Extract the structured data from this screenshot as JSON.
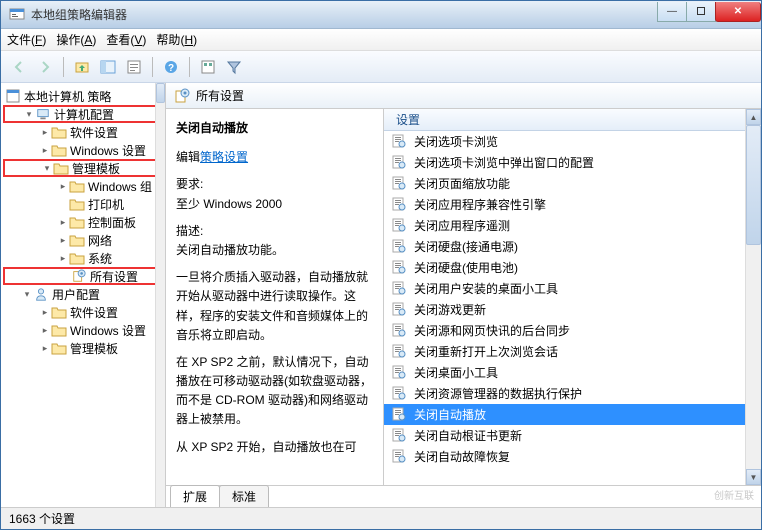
{
  "window": {
    "title": "本地组策略编辑器"
  },
  "menubar": [
    {
      "label": "文件",
      "accel": "F"
    },
    {
      "label": "操作",
      "accel": "A"
    },
    {
      "label": "查看",
      "accel": "V"
    },
    {
      "label": "帮助",
      "accel": "H"
    }
  ],
  "tree": {
    "root": "本地计算机 策略",
    "nodes": [
      {
        "label": "计算机配置",
        "level": 1,
        "twist": "▾",
        "hl": true,
        "icon": "computer"
      },
      {
        "label": "软件设置",
        "level": 2,
        "twist": "▸",
        "icon": "folder"
      },
      {
        "label": "Windows 设置",
        "level": 2,
        "twist": "▸",
        "icon": "folder"
      },
      {
        "label": "管理模板",
        "level": 2,
        "twist": "▾",
        "hl": true,
        "icon": "folder"
      },
      {
        "label": "Windows 组",
        "level": 3,
        "twist": "▸",
        "icon": "folder"
      },
      {
        "label": "打印机",
        "level": 3,
        "twist": "",
        "icon": "folder"
      },
      {
        "label": "控制面板",
        "level": 3,
        "twist": "▸",
        "icon": "folder"
      },
      {
        "label": "网络",
        "level": 3,
        "twist": "▸",
        "icon": "folder"
      },
      {
        "label": "系统",
        "level": 3,
        "twist": "▸",
        "icon": "folder"
      },
      {
        "label": "所有设置",
        "level": 3,
        "twist": "",
        "hl": true,
        "icon": "settings"
      },
      {
        "label": "用户配置",
        "level": 1,
        "twist": "▾",
        "icon": "user"
      },
      {
        "label": "软件设置",
        "level": 2,
        "twist": "▸",
        "icon": "folder"
      },
      {
        "label": "Windows 设置",
        "level": 2,
        "twist": "▸",
        "icon": "folder"
      },
      {
        "label": "管理模板",
        "level": 2,
        "twist": "▸",
        "icon": "folder"
      }
    ]
  },
  "content_header": "所有设置",
  "info": {
    "title": "关闭自动播放",
    "edit_prefix": "编辑",
    "edit_link": "策略设置",
    "req_label": "要求:",
    "req_value": "至少 Windows 2000",
    "desc_label": "描述:",
    "desc1": "关闭自动播放功能。",
    "desc2": "一旦将介质插入驱动器，自动播放就开始从驱动器中进行读取操作。这样，程序的安装文件和音频媒体上的音乐将立即启动。",
    "desc3": "在 XP SP2 之前，默认情况下，自动播放在可移动驱动器(如软盘驱动器，而不是 CD-ROM 驱动器)和网络驱动器上被禁用。",
    "desc4": "从 XP SP2 开始，自动播放也在可"
  },
  "list": {
    "header": "设置",
    "items": [
      "关闭选项卡浏览",
      "关闭选项卡浏览中弹出窗口的配置",
      "关闭页面缩放功能",
      "关闭应用程序兼容性引擎",
      "关闭应用程序遥测",
      "关闭硬盘(接通电源)",
      "关闭硬盘(使用电池)",
      "关闭用户安装的桌面小工具",
      "关闭游戏更新",
      "关闭源和网页快讯的后台同步",
      "关闭重新打开上次浏览会话",
      "关闭桌面小工具",
      "关闭资源管理器的数据执行保护",
      "关闭自动播放",
      "关闭自动根证书更新",
      "关闭自动故障恢复"
    ],
    "selected_index": 13
  },
  "tabs": {
    "active": "扩展",
    "inactive": "标准"
  },
  "status": "1663 个设置",
  "watermark": "创新互联"
}
